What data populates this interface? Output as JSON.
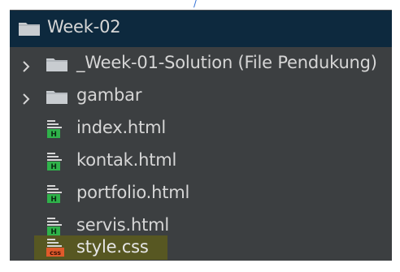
{
  "window": {
    "tree": {
      "root": {
        "label": "Week-02",
        "icon": "folder-icon"
      },
      "items": [
        {
          "label": "_Week-01-Solution (File Pendukung)",
          "type": "folder",
          "expanded": false
        },
        {
          "label": "gambar",
          "type": "folder",
          "expanded": false
        },
        {
          "label": "index.html",
          "type": "html"
        },
        {
          "label": "kontak.html",
          "type": "html"
        },
        {
          "label": "portfolio.html",
          "type": "html"
        },
        {
          "label": "servis.html",
          "type": "html"
        },
        {
          "label": "style.css",
          "type": "css",
          "highlighted": true
        }
      ]
    }
  },
  "colors": {
    "panel_bg": "#3c3f41",
    "selected_row_bg": "#0d293e",
    "text": "#d6d6d6",
    "folder": "#c8ccd0",
    "html_file_accent": "#2fb24a",
    "css_file_accent": "#e05a2b",
    "highlight": "#5a5a1f"
  }
}
